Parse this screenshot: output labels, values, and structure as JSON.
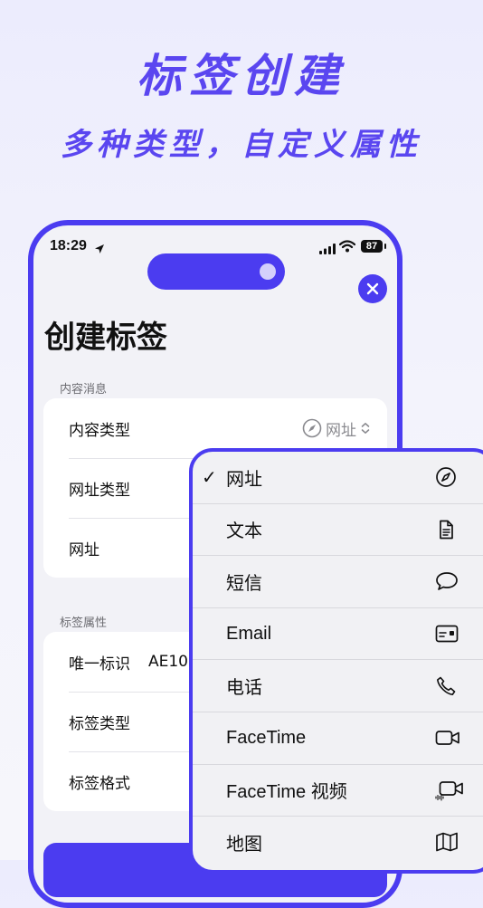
{
  "promo": {
    "headline": "标签创建",
    "subhead": "多种类型，自定义属性"
  },
  "status_bar": {
    "time": "18:29",
    "battery": "87"
  },
  "sheet": {
    "title": "创建标签",
    "content_section": {
      "header": "内容消息",
      "rows": [
        {
          "label": "内容类型",
          "value": "网址",
          "value_icon": "compass-icon"
        },
        {
          "label": "网址类型"
        },
        {
          "label": "网址"
        }
      ]
    },
    "tag_section": {
      "header": "标签属性",
      "rows": [
        {
          "label": "唯一标识",
          "value": "AE10"
        },
        {
          "label": "标签类型"
        },
        {
          "label": "标签格式"
        }
      ]
    }
  },
  "menu": {
    "selected": "网址",
    "items": [
      {
        "label": "网址",
        "checked": true,
        "icon": "compass-icon"
      },
      {
        "label": "文本",
        "checked": false,
        "icon": "document-icon"
      },
      {
        "label": "短信",
        "checked": false,
        "icon": "message-bubble-icon"
      },
      {
        "label": "Email",
        "checked": false,
        "icon": "contact-card-icon"
      },
      {
        "label": "电话",
        "checked": false,
        "icon": "phone-icon"
      },
      {
        "label": "FaceTime",
        "checked": false,
        "icon": "video-camera-icon"
      },
      {
        "label": "FaceTime 视频",
        "checked": false,
        "icon": "video-waveform-icon"
      },
      {
        "label": "地图",
        "checked": false,
        "icon": "map-icon"
      }
    ],
    "check_mark": "✓"
  },
  "colors": {
    "accent": "#4b3cf0",
    "promo_text": "#5a46f0",
    "background": "#ececfd"
  }
}
